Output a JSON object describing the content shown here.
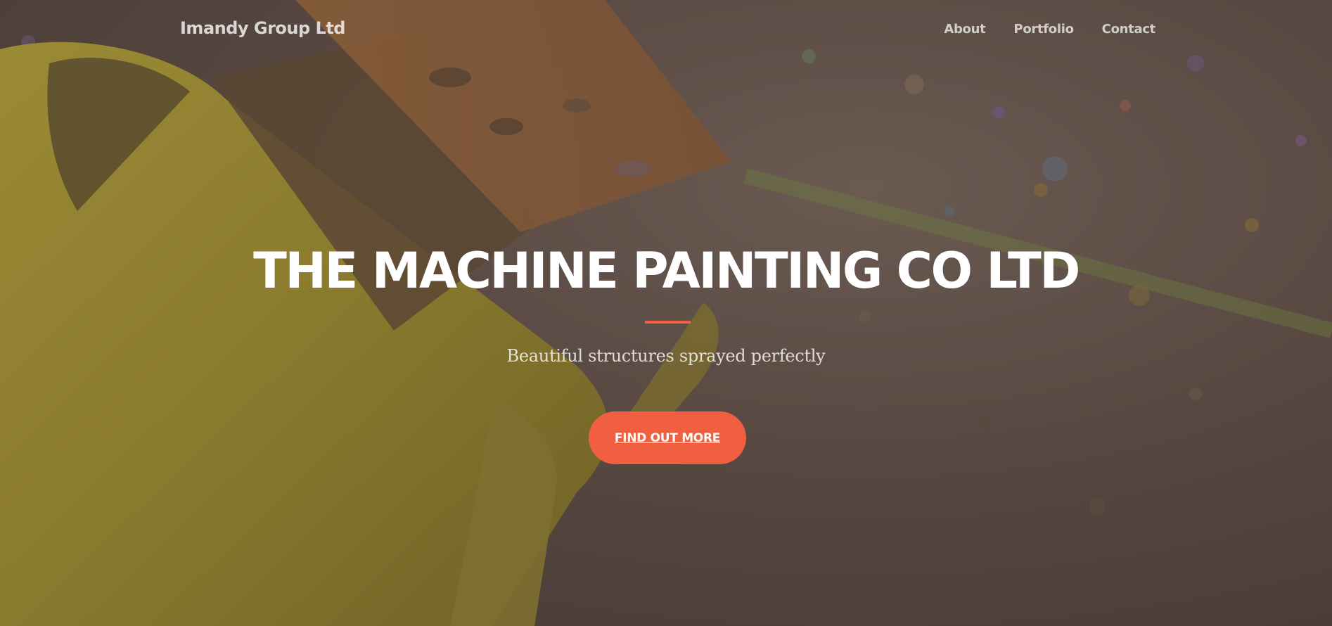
{
  "navbar": {
    "brand": "Imandy Group Ltd",
    "links": [
      {
        "label": "About"
      },
      {
        "label": "Portfolio"
      },
      {
        "label": "Contact"
      }
    ]
  },
  "hero": {
    "title": "THE MACHINE PAINTING CO LTD",
    "subtitle": "Beautiful structures sprayed perfectly",
    "cta_label": "FIND OUT MORE",
    "background_icon": "paint-bucket-brush-photo"
  },
  "colors": {
    "accent": "#f05f40",
    "overlay": "#4d4039",
    "paint_yellow": "#8a7a30"
  }
}
